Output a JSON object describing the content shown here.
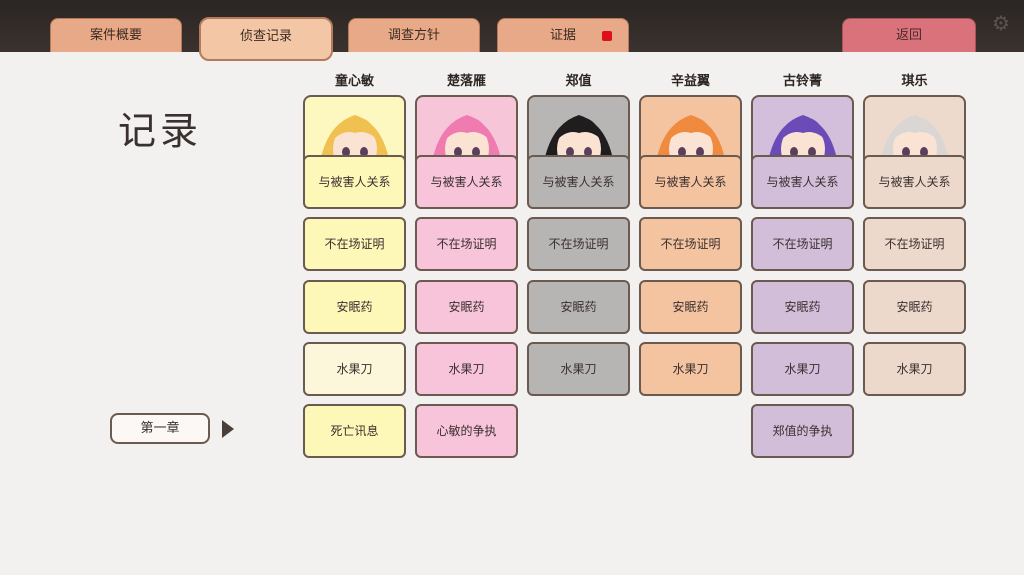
{
  "tabs": [
    {
      "label": "案件概要"
    },
    {
      "label": "侦查记录",
      "active": true
    },
    {
      "label": "调查方针"
    },
    {
      "label": "证据",
      "badge": true
    }
  ],
  "back_label": "返回",
  "title": "记录",
  "chapter_label": "第一章",
  "colors": {
    "yellow": "#fdf7b8",
    "pink": "#f7c4da",
    "gray": "#b7b5b3",
    "orange": "#f4c39f",
    "purple": "#d2bed9",
    "beige": "#ecd9cc"
  },
  "characters": [
    {
      "name": "童心敏",
      "bg": "#fdf8c0",
      "hair": "#f0c050",
      "cards": [
        "与被害人关系",
        "不在场证明",
        "安眠药",
        "水果刀",
        "死亡讯息"
      ],
      "card_colors": [
        "#fdf7b8",
        "#fdf7b8",
        "#fdf7b8",
        "#fcf6db",
        "#fdf7b8"
      ]
    },
    {
      "name": "楚落雁",
      "bg": "#f6c6d8",
      "hair": "#f07bb0",
      "cards": [
        "与被害人关系",
        "不在场证明",
        "安眠药",
        "水果刀",
        "心敏的争执"
      ],
      "card_colors": [
        "#f7c4da",
        "#f7c4da",
        "#f7c4da",
        "#f7c4da",
        "#f7c4da"
      ]
    },
    {
      "name": "郑值",
      "bg": "#b8b6b4",
      "hair": "#1f1d1e",
      "cards": [
        "与被害人关系",
        "不在场证明",
        "安眠药",
        "水果刀"
      ],
      "card_colors": [
        "#b7b5b3",
        "#b7b5b3",
        "#b7b5b3",
        "#b7b5b3"
      ]
    },
    {
      "name": "辛益翼",
      "bg": "#f4c4a0",
      "hair": "#ef8a3e",
      "cards": [
        "与被害人关系",
        "不在场证明",
        "安眠药",
        "水果刀"
      ],
      "card_colors": [
        "#f4c39f",
        "#f4c39f",
        "#f4c39f",
        "#f4c39f"
      ]
    },
    {
      "name": "古铃菁",
      "bg": "#d3bfdb",
      "hair": "#6a4bb8",
      "cards": [
        "与被害人关系",
        "不在场证明",
        "安眠药",
        "水果刀",
        "郑值的争执"
      ],
      "card_colors": [
        "#d2bed9",
        "#d2bed9",
        "#d2bed9",
        "#d2bed9",
        "#d2bed9"
      ]
    },
    {
      "name": "琪乐",
      "bg": "#eddacd",
      "hair": "#d9d6d3",
      "cards": [
        "与被害人关系",
        "不在场证明",
        "安眠药",
        "水果刀"
      ],
      "card_colors": [
        "#ecd9cc",
        "#ecd9cc",
        "#ecd9cc",
        "#ecd9cc"
      ]
    }
  ]
}
